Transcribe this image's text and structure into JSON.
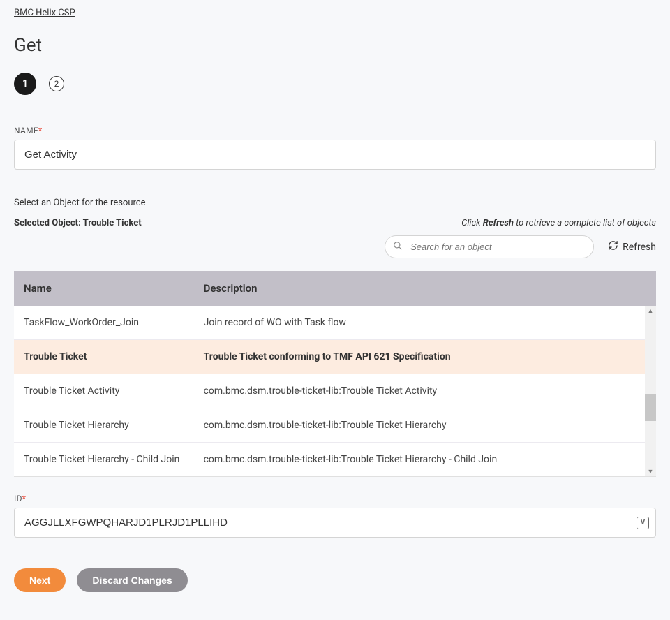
{
  "breadcrumb": {
    "label": "BMC Helix CSP"
  },
  "page": {
    "title": "Get"
  },
  "steps": {
    "one": "1",
    "two": "2"
  },
  "fields": {
    "name": {
      "label": "NAME",
      "value": "Get Activity"
    },
    "id": {
      "label": "ID",
      "value": "AGGJLLXFGWPQHARJD1PLRJD1PLLIHD",
      "icon_letter": "V"
    }
  },
  "object_select": {
    "instructions": "Select an Object for the resource",
    "selected_prefix": "Selected Object: ",
    "selected_name": "Trouble Ticket",
    "hint_prefix": "Click ",
    "hint_bold": "Refresh",
    "hint_suffix": " to retrieve a complete list of objects"
  },
  "search": {
    "placeholder": "Search for an object"
  },
  "refresh": {
    "label": "Refresh"
  },
  "table": {
    "headers": {
      "name": "Name",
      "description": "Description"
    },
    "rows": [
      {
        "name": "TaskFlow_WorkOrder_Join",
        "description": "Join record of WO with Task flow",
        "selected": false
      },
      {
        "name": "Trouble Ticket",
        "description": "Trouble Ticket conforming to TMF API 621 Specification",
        "selected": true
      },
      {
        "name": "Trouble Ticket Activity",
        "description": "com.bmc.dsm.trouble-ticket-lib:Trouble Ticket Activity",
        "selected": false
      },
      {
        "name": "Trouble Ticket Hierarchy",
        "description": "com.bmc.dsm.trouble-ticket-lib:Trouble Ticket Hierarchy",
        "selected": false
      },
      {
        "name": "Trouble Ticket Hierarchy - Child Join",
        "description": "com.bmc.dsm.trouble-ticket-lib:Trouble Ticket Hierarchy - Child Join",
        "selected": false
      }
    ]
  },
  "buttons": {
    "next": "Next",
    "discard": "Discard Changes"
  }
}
